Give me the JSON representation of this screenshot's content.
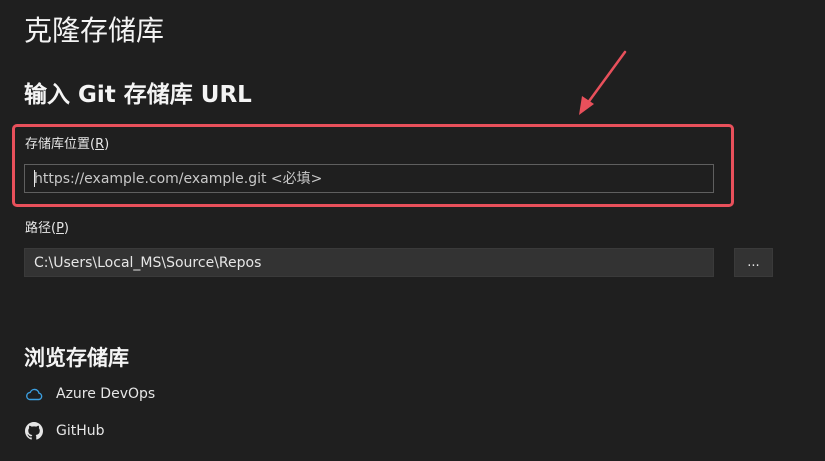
{
  "page_title": "克隆存储库",
  "section_heading": "输入 Git 存储库 URL",
  "repo_location": {
    "label_text": "存储库位置(",
    "label_accel": "R",
    "label_close": ")",
    "placeholder": "https://example.com/example.git <必填>",
    "value": ""
  },
  "path": {
    "label_text": "路径(",
    "label_accel": "P",
    "label_close": ")",
    "value": "C:\\Users\\Local_MS\\Source\\Repos"
  },
  "browse_button_label": "...",
  "browse_section": {
    "heading": "浏览存储库",
    "providers": [
      {
        "label": "Azure DevOps",
        "icon": "cloud-icon"
      },
      {
        "label": "GitHub",
        "icon": "github-icon"
      }
    ]
  },
  "colors": {
    "background": "#1f1f1f",
    "highlight": "#e8505b",
    "azure_icon": "#3c9fe0"
  }
}
